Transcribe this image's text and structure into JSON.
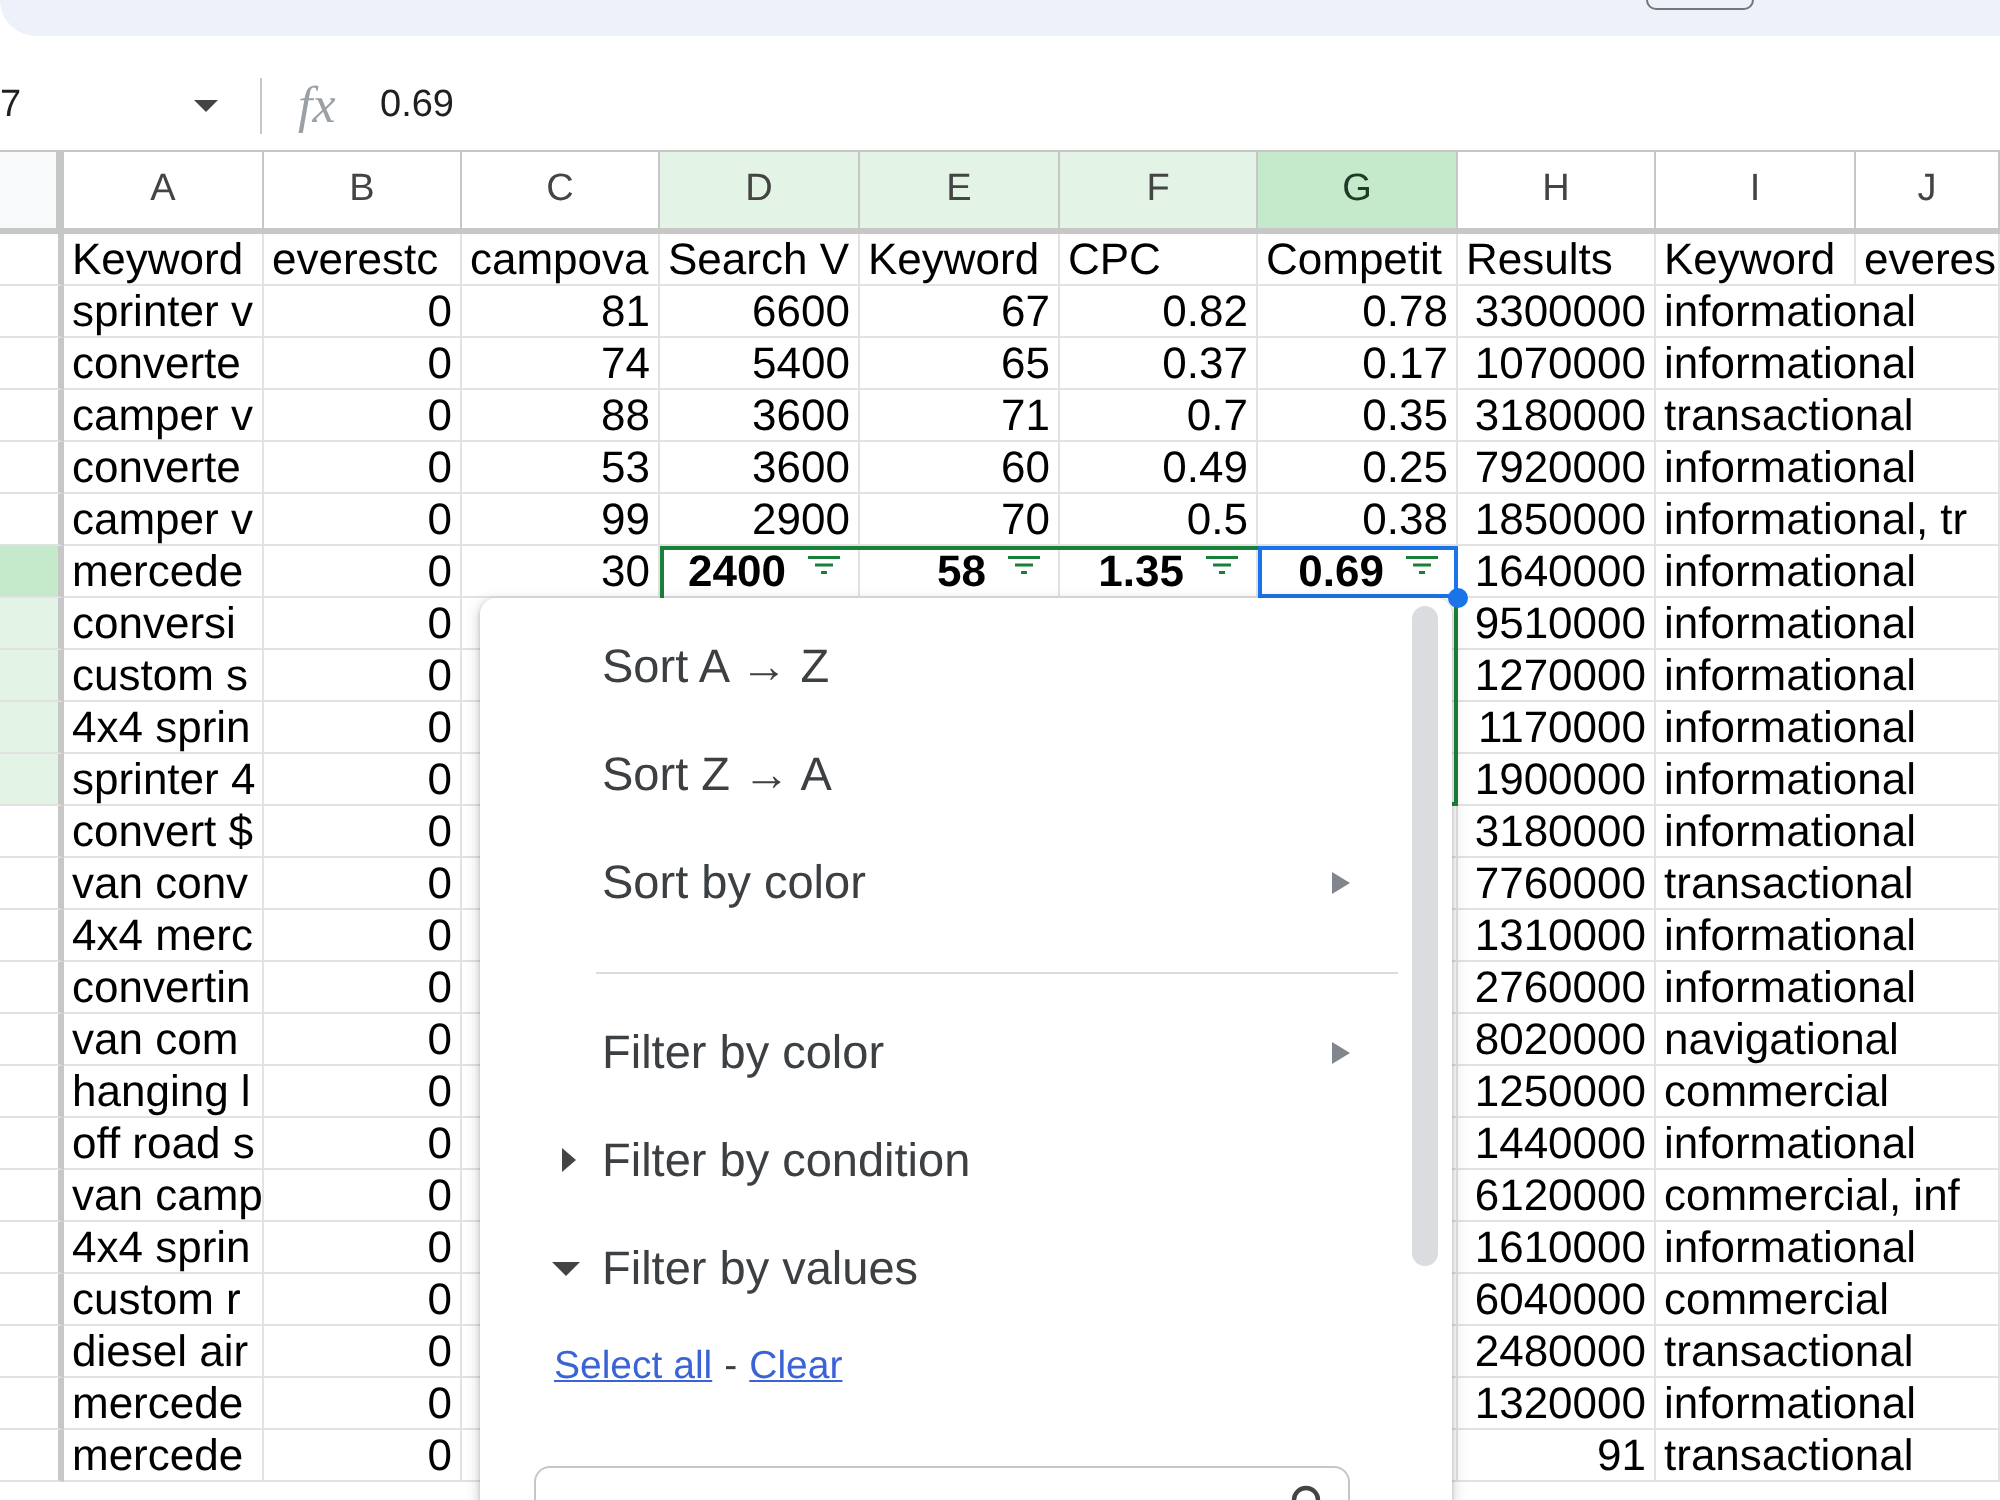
{
  "formula_bar": {
    "name_box": "7",
    "function_label": "fx",
    "formula": "0.69"
  },
  "sheet": {
    "columns": [
      {
        "label": "A",
        "kind": "text",
        "selected": false,
        "active": false
      },
      {
        "label": "B",
        "kind": "number",
        "selected": false,
        "active": false
      },
      {
        "label": "C",
        "kind": "number",
        "selected": false,
        "active": false
      },
      {
        "label": "D",
        "kind": "number",
        "selected": true,
        "active": false
      },
      {
        "label": "E",
        "kind": "number",
        "selected": true,
        "active": false
      },
      {
        "label": "F",
        "kind": "number",
        "selected": true,
        "active": false
      },
      {
        "label": "G",
        "kind": "number",
        "selected": true,
        "active": true
      },
      {
        "label": "H",
        "kind": "number",
        "selected": false,
        "active": false
      },
      {
        "label": "I",
        "kind": "text",
        "selected": false,
        "active": false
      },
      {
        "label": "J",
        "selected": false,
        "active": false
      }
    ],
    "rows": [
      {
        "kind": "header",
        "selected": false,
        "active": false,
        "cells": [
          "Keyword",
          "everestc",
          "campova",
          "Search V",
          "Keyword",
          "CPC",
          "Competit",
          "Results",
          "Keyword",
          "everes"
        ]
      },
      {
        "kind": "data",
        "selected": false,
        "active": false,
        "cells": [
          "sprinter v",
          "0",
          "81",
          "6600",
          "67",
          "0.82",
          "0.78",
          "3300000",
          "informational"
        ]
      },
      {
        "kind": "data",
        "selected": false,
        "active": false,
        "cells": [
          "converte",
          "0",
          "74",
          "5400",
          "65",
          "0.37",
          "0.17",
          "1070000",
          "informational"
        ]
      },
      {
        "kind": "data",
        "selected": false,
        "active": false,
        "cells": [
          "camper v",
          "0",
          "88",
          "3600",
          "71",
          "0.7",
          "0.35",
          "3180000",
          "transactional"
        ]
      },
      {
        "kind": "data",
        "selected": false,
        "active": false,
        "cells": [
          "converte",
          "0",
          "53",
          "3600",
          "60",
          "0.49",
          "0.25",
          "7920000",
          "informational"
        ]
      },
      {
        "kind": "data",
        "selected": false,
        "active": false,
        "cells": [
          "camper v",
          "0",
          "99",
          "2900",
          "70",
          "0.5",
          "0.38",
          "1850000",
          "informational, tr"
        ]
      },
      {
        "kind": "data",
        "selected": true,
        "active": true,
        "cells": [
          "mercede",
          "0",
          "30",
          "2400",
          "58",
          "1.35",
          "0.69",
          "1640000",
          "informational"
        ]
      },
      {
        "kind": "data",
        "selected": true,
        "active": false,
        "cells": [
          "conversi",
          "0",
          null,
          null,
          null,
          null,
          null,
          "9510000",
          "informational"
        ]
      },
      {
        "kind": "data",
        "selected": true,
        "active": false,
        "cells": [
          "custom s",
          "0",
          null,
          null,
          null,
          null,
          null,
          "1270000",
          "informational"
        ]
      },
      {
        "kind": "data",
        "selected": true,
        "active": false,
        "cells": [
          "4x4 sprin",
          "0",
          null,
          null,
          null,
          null,
          null,
          "1170000",
          "informational"
        ]
      },
      {
        "kind": "data",
        "selected": true,
        "active": false,
        "cells": [
          "sprinter 4",
          "0",
          null,
          null,
          null,
          null,
          null,
          "1900000",
          "informational"
        ]
      },
      {
        "kind": "data",
        "selected": false,
        "active": false,
        "cells": [
          "convert $",
          "0",
          null,
          null,
          null,
          null,
          null,
          "3180000",
          "informational"
        ]
      },
      {
        "kind": "data",
        "selected": false,
        "active": false,
        "cells": [
          "van conv",
          "0",
          null,
          null,
          null,
          null,
          null,
          "7760000",
          "transactional"
        ]
      },
      {
        "kind": "data",
        "selected": false,
        "active": false,
        "cells": [
          "4x4 merc",
          "0",
          null,
          null,
          null,
          null,
          null,
          "1310000",
          "informational"
        ]
      },
      {
        "kind": "data",
        "selected": false,
        "active": false,
        "cells": [
          "convertin",
          "0",
          null,
          null,
          null,
          null,
          null,
          "2760000",
          "informational"
        ]
      },
      {
        "kind": "data",
        "selected": false,
        "active": false,
        "cells": [
          "van com",
          "0",
          null,
          null,
          null,
          null,
          null,
          "8020000",
          "navigational"
        ]
      },
      {
        "kind": "data",
        "selected": false,
        "active": false,
        "cells": [
          "hanging l",
          "0",
          null,
          null,
          null,
          null,
          null,
          "1250000",
          "commercial"
        ]
      },
      {
        "kind": "data",
        "selected": false,
        "active": false,
        "cells": [
          "off road s",
          "0",
          null,
          null,
          null,
          null,
          null,
          "1440000",
          "informational"
        ]
      },
      {
        "kind": "data",
        "selected": false,
        "active": false,
        "cells": [
          "van camp",
          "0",
          null,
          null,
          null,
          null,
          null,
          "6120000",
          "commercial, inf"
        ]
      },
      {
        "kind": "data",
        "selected": false,
        "active": false,
        "cells": [
          "4x4 sprin",
          "0",
          null,
          null,
          null,
          null,
          null,
          "1610000",
          "informational"
        ]
      },
      {
        "kind": "data",
        "selected": false,
        "active": false,
        "cells": [
          "custom r",
          "0",
          null,
          null,
          null,
          null,
          null,
          "6040000",
          "commercial"
        ]
      },
      {
        "kind": "data",
        "selected": false,
        "active": false,
        "cells": [
          "diesel air",
          "0",
          null,
          null,
          null,
          null,
          null,
          "2480000",
          "transactional"
        ]
      },
      {
        "kind": "data",
        "selected": false,
        "active": false,
        "cells": [
          "mercede",
          "0",
          null,
          null,
          null,
          null,
          null,
          "1320000",
          "informational"
        ]
      },
      {
        "kind": "data",
        "selected": false,
        "active": false,
        "cells": [
          "mercede",
          "0",
          null,
          null,
          null,
          null,
          null,
          "91",
          "transactional"
        ]
      }
    ]
  },
  "filter_menu": {
    "items": [
      {
        "kind": "action",
        "label": "Sort A → Z"
      },
      {
        "kind": "action",
        "label": "Sort Z → A"
      },
      {
        "kind": "submenu",
        "label": "Sort by color"
      },
      {
        "kind": "divider"
      },
      {
        "kind": "submenu",
        "label": "Filter by color"
      },
      {
        "kind": "section",
        "label": "Filter by condition",
        "expanded": false
      },
      {
        "kind": "section",
        "label": "Filter by values",
        "expanded": true
      },
      {
        "kind": "links",
        "links": [
          "Select all",
          "Clear"
        ],
        "separator": "-"
      },
      {
        "kind": "search"
      }
    ]
  }
}
